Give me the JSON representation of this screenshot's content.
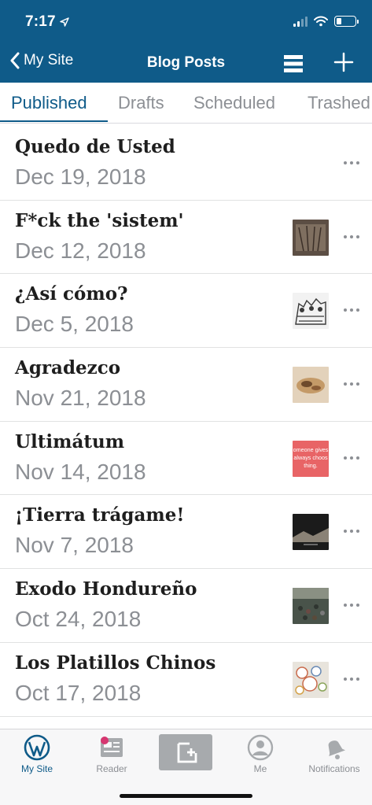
{
  "status_bar": {
    "time": "7:17",
    "battery_level": 0.25
  },
  "nav": {
    "back_label": "My Site",
    "title": "Blog Posts"
  },
  "tabs": [
    {
      "label": "Published",
      "active": true
    },
    {
      "label": "Drafts",
      "active": false
    },
    {
      "label": "Scheduled",
      "active": false
    },
    {
      "label": "Trashed",
      "active": false
    }
  ],
  "posts": [
    {
      "title": "Quedo de Usted",
      "date": "Dec 19, 2018",
      "has_thumbnail": false
    },
    {
      "title": "F*ck the 'sistem'",
      "date": "Dec 12, 2018",
      "has_thumbnail": true,
      "thumb_colors": [
        "#5c4e44",
        "#9c8a78"
      ]
    },
    {
      "title": "¿Así cómo?",
      "date": "Dec 5, 2018",
      "has_thumbnail": true,
      "thumb_colors": [
        "#f2f2f2",
        "#3a3a3a"
      ]
    },
    {
      "title": "Agradezco",
      "date": "Nov 21, 2018",
      "has_thumbnail": true,
      "thumb_colors": [
        "#c49a68",
        "#6e4a2c"
      ]
    },
    {
      "title": "Ultimátum",
      "date": "Nov 14, 2018",
      "has_thumbnail": true,
      "thumb_colors": [
        "#e86466",
        "#ffffff"
      ],
      "thumb_text": [
        "omeone gives",
        "always choos",
        "thing."
      ]
    },
    {
      "title": "¡Tierra trágame!",
      "date": "Nov 7, 2018",
      "has_thumbnail": true,
      "thumb_colors": [
        "#1b1b1b",
        "#8a8276"
      ]
    },
    {
      "title": "Exodo Hondureño",
      "date": "Oct 24, 2018",
      "has_thumbnail": true,
      "thumb_colors": [
        "#49534a",
        "#8a9083"
      ]
    },
    {
      "title": "Los Platillos Chinos",
      "date": "Oct 17, 2018",
      "has_thumbnail": true,
      "thumb_colors": [
        "#e8e4dc",
        "#c96a4b"
      ]
    }
  ],
  "tabbar": {
    "my_site": "My Site",
    "reader": "Reader",
    "me": "Me",
    "notifications": "Notifications"
  },
  "colors": {
    "brand": "#0f5b89",
    "muted": "#8c8f94",
    "new_post_button": "#a7aaad",
    "reader_badge": "#d63670"
  }
}
